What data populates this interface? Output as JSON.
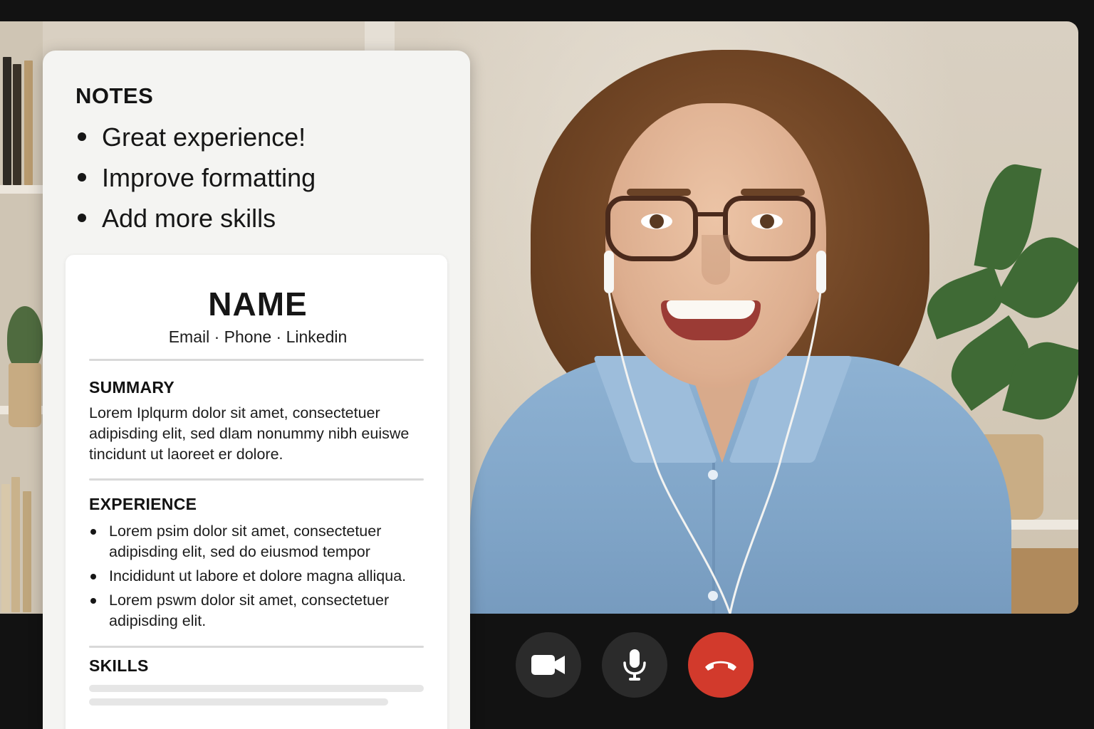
{
  "notes": {
    "title": "NOTES",
    "items": [
      "Great experience!",
      "Improve formatting",
      "Add more skills"
    ]
  },
  "resume": {
    "name": "NAME",
    "contact": "Email · Phone · Linkedin",
    "summary": {
      "heading": "SUMMARY",
      "text": "Lorem Iplqurm dolor sit amet, consectetuer adipisding elit, sed dlam nonummy nibh euiswe tincidunt ut laoreet er dolore."
    },
    "experience": {
      "heading": "EXPERIENCE",
      "items": [
        "Lorem psim dolor sit amet, consectetuer adipisding elit, sed do eiusmod tempor",
        "Incididunt ut labore et dolore magna alliqua.",
        "Lorem pswm dolor sit amet, consectetuer adipisding elit."
      ]
    },
    "skills": {
      "heading": "SKILLS"
    }
  },
  "controls": {
    "camera": "video-camera-icon",
    "mic": "microphone-icon",
    "end_call": "hang-up-phone-icon",
    "end_call_color": "#d23a2c"
  }
}
